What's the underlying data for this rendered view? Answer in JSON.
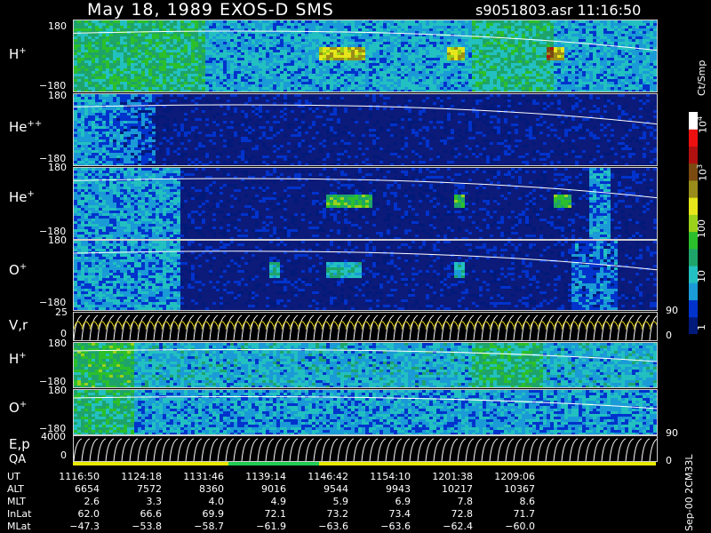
{
  "title": {
    "left": "May 18, 1989   EXOS-D SMS",
    "right": "s9051803.asr  11:16:50"
  },
  "colorbar": {
    "unit_label": "Ct/Smp",
    "tick_labels": [
      "1",
      "10",
      "100",
      "10",
      "10"
    ],
    "tick_exponents": [
      "",
      "",
      "",
      "3",
      "4"
    ],
    "colors": [
      "#001a7a",
      "#0033cc",
      "#1a9ad6",
      "#22c0c0",
      "#1ea46a",
      "#2bbf2b",
      "#9bd11a",
      "#e6e61a",
      "#9a8c1a",
      "#7a4a10",
      "#b01010",
      "#ee1010",
      "#ffffff"
    ]
  },
  "chart_data": [
    {
      "type": "heatmap",
      "panel": "H+",
      "label_base": "H",
      "label_sup": "+",
      "ylim": [
        -180,
        180
      ],
      "yticks": [
        "180",
        "−180"
      ]
    },
    {
      "type": "heatmap",
      "panel": "He++",
      "label_base": "He",
      "label_sup": "++",
      "ylim": [
        -180,
        180
      ],
      "yticks": [
        "180",
        "−180"
      ]
    },
    {
      "type": "heatmap",
      "panel": "He+",
      "label_base": "He",
      "label_sup": "+",
      "ylim": [
        -180,
        180
      ],
      "yticks": [
        "180",
        "−180"
      ]
    },
    {
      "type": "heatmap",
      "panel": "O+",
      "label_base": "O",
      "label_sup": "+",
      "ylim": [
        -180,
        180
      ],
      "yticks": [
        "180",
        "−180"
      ]
    },
    {
      "type": "line",
      "panel": "V,r",
      "label_base": "V,r",
      "label_sup": "",
      "ylim": [
        0,
        25
      ],
      "yticks": [
        "25",
        "0"
      ],
      "right_ticks": [
        "90",
        "0"
      ]
    },
    {
      "type": "heatmap",
      "panel": "H+ (2)",
      "label_base": "H",
      "label_sup": "+",
      "ylim": [
        -180,
        180
      ],
      "yticks": [
        "180",
        "−180"
      ]
    },
    {
      "type": "heatmap",
      "panel": "O+ (2)",
      "label_base": "O",
      "label_sup": "+",
      "ylim": [
        -180,
        180
      ],
      "yticks": [
        "180",
        "−180"
      ]
    },
    {
      "type": "line",
      "panel": "E,p",
      "label_base": "E,p",
      "label_sup": "",
      "ylim": [
        0,
        4000
      ],
      "yticks": [
        "4000",
        "0"
      ],
      "right_ticks": [
        "90",
        "0"
      ]
    }
  ],
  "qa_label": "QA",
  "table": {
    "rows": [
      {
        "label": "UT",
        "values": [
          "1116:50",
          "1124:18",
          "1131:46",
          "1139:14",
          "1146:42",
          "1154:10",
          "1201:38",
          "1209:06"
        ]
      },
      {
        "label": "ALT",
        "values": [
          "6654",
          "7572",
          "8360",
          "9016",
          "9544",
          "9943",
          "10217",
          "10367"
        ]
      },
      {
        "label": "MLT",
        "values": [
          "2.6",
          "3.3",
          "4.0",
          "4.9",
          "5.9",
          "6.9",
          "7.8",
          "8.6"
        ]
      },
      {
        "label": "InLat",
        "values": [
          "62.0",
          "66.6",
          "69.9",
          "72.1",
          "73.2",
          "73.4",
          "72.8",
          "71.7"
        ]
      },
      {
        "label": "MLat",
        "values": [
          "−47.3",
          "−53.8",
          "−58.7",
          "−61.9",
          "−63.6",
          "−63.6",
          "−62.4",
          "−60.0"
        ]
      }
    ]
  },
  "footer_tag": "Sep-00 2CM33L"
}
